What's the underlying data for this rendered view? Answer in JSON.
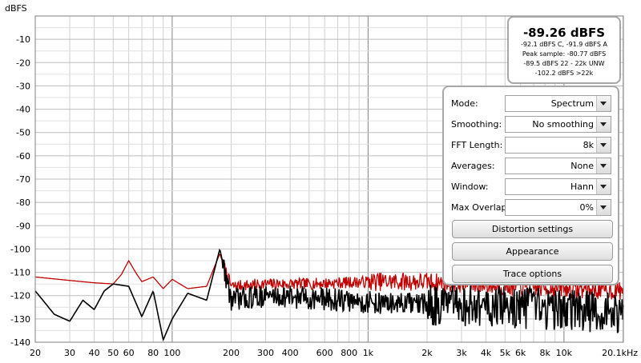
{
  "plot": {
    "y_axis_label": "dBFS",
    "y_ticks": [
      "-10",
      "-20",
      "-30",
      "-40",
      "-50",
      "-60",
      "-70",
      "-80",
      "-90",
      "-100",
      "-110",
      "-120",
      "-130",
      "-140"
    ],
    "x_ticks": [
      "20",
      "30",
      "40",
      "50",
      "60",
      "80",
      "100",
      "200",
      "300",
      "400",
      "600",
      "800",
      "1k",
      "2k",
      "3k",
      "4k",
      "5k",
      "6k",
      "8k",
      "10k",
      "20.1kHz"
    ]
  },
  "chart_data": {
    "type": "line",
    "ylabel": "dBFS",
    "ylim": [
      -140,
      0
    ],
    "xlim": [
      20,
      20100
    ],
    "x_scale": "log",
    "grid": true,
    "series": [
      {
        "color": "#c00000",
        "x": [
          20,
          30,
          40,
          50,
          55,
          60,
          65,
          70,
          80,
          90,
          100,
          120,
          150,
          175,
          200,
          300,
          500,
          1000,
          2000,
          5000,
          10000,
          20000
        ],
        "y": [
          -112,
          -113.5,
          -114.5,
          -115,
          -111,
          -105,
          -110,
          -114,
          -112,
          -117,
          -113,
          -117,
          -116,
          -102,
          -116,
          -115,
          -115,
          -114,
          -114,
          -116,
          -117,
          -118
        ]
      },
      {
        "color": "#000000",
        "x": [
          20,
          25,
          30,
          35,
          40,
          45,
          50,
          60,
          70,
          80,
          90,
          100,
          120,
          150,
          175,
          200,
          300,
          500,
          1000,
          2000,
          5000,
          10000,
          20000
        ],
        "y": [
          -118,
          -128,
          -131,
          -122,
          -126,
          -118,
          -115,
          -116,
          -129,
          -118,
          -139,
          -130,
          -119,
          -122,
          -100,
          -122,
          -120,
          -121,
          -123,
          -124,
          -125,
          -126,
          -128
        ]
      }
    ]
  },
  "readout": {
    "main": "-89.26 dBFS",
    "line1": "-92.1 dBFS C, -91.9 dBFS A",
    "line2": "Peak sample: -80.77 dBFS",
    "line3": "-89.5 dBFS 22 - 22k UNW",
    "line4": "-102.2 dBFS >22k"
  },
  "controls": {
    "mode": {
      "label": "Mode:",
      "value": "Spectrum"
    },
    "smoothing": {
      "label": "Smoothing:",
      "value": "No  smoothing"
    },
    "fft_length": {
      "label": "FFT Length:",
      "value": "8k"
    },
    "averages": {
      "label": "Averages:",
      "value": "None"
    },
    "window": {
      "label": "Window:",
      "value": "Hann"
    },
    "max_overlap": {
      "label": "Max Overlap:",
      "value": "0%"
    },
    "distortion_button": "Distortion settings",
    "appearance_button": "Appearance",
    "trace_options_button": "Trace options"
  }
}
